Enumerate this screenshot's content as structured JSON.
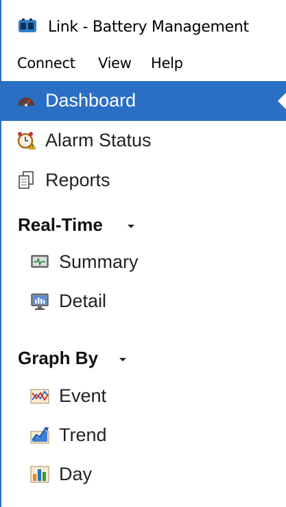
{
  "window": {
    "title": "Link - Battery Management",
    "accent": "#2a6fc4"
  },
  "menu": {
    "connect": "Connect",
    "view": "View",
    "help": "Help"
  },
  "nav": {
    "dashboard": "Dashboard",
    "alarm_status": "Alarm Status",
    "reports": "Reports",
    "realtime_header": "Real-Time",
    "summary": "Summary",
    "detail": "Detail",
    "graph_header": "Graph By",
    "event": "Event",
    "trend": "Trend",
    "day": "Day",
    "active_item": "Dashboard"
  },
  "icons": {
    "app": "battery-app-icon",
    "dashboard": "speedometer-icon",
    "alarm_status": "alarm-clock-icon",
    "reports": "documents-icon",
    "summary": "monitor-waveform-icon",
    "detail": "monitor-chart-icon",
    "event": "event-graph-icon",
    "trend": "trend-graph-icon",
    "day": "bar-chart-icon"
  }
}
